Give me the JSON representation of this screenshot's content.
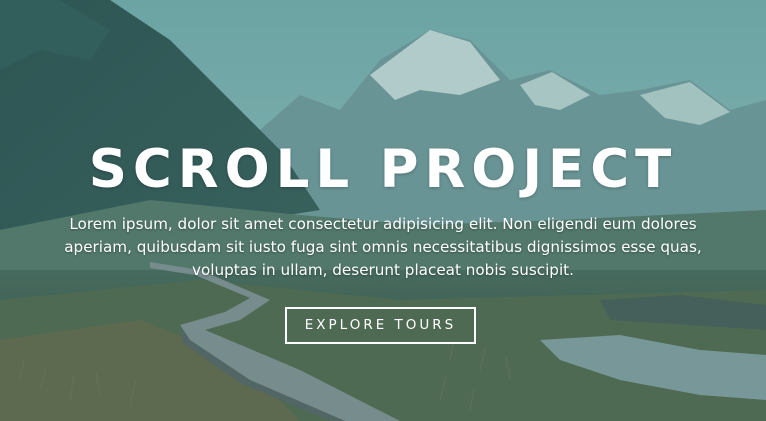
{
  "hero": {
    "title": "SCROLL PROJECT",
    "description": "Lorem ipsum, dolor sit amet consectetur adipisicing elit. Non eligendi eum dolores aperiam, quibusdam sit iusto fuga sint omnis necessitatibus dignissimos esse quas, voluptas in ullam, deserunt placeat nobis suscipit.",
    "button_label": "Explore Tours"
  },
  "colors": {
    "overlay_tint": "#2f7f7c",
    "text": "#ffffff",
    "button_border": "#ffffff"
  }
}
